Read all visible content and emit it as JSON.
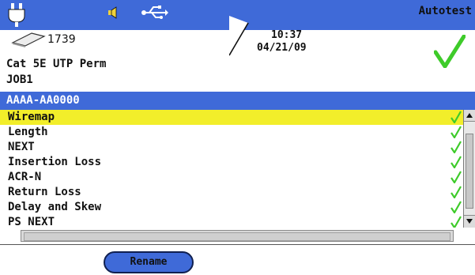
{
  "header": {
    "mode_title": "Autotest",
    "status_icons": [
      "plug-icon",
      "speaker-icon",
      "usb-icon"
    ]
  },
  "info": {
    "counter": "1739",
    "time": "10:37",
    "date": "04/21/09",
    "cable_type": "Cat 5E UTP Perm",
    "job": "JOB1",
    "overall_result_icon": "pass-check-icon"
  },
  "cable_id": "AAAA-AA0000",
  "tests": [
    {
      "label": "Wiremap",
      "result": "pass"
    },
    {
      "label": "Length",
      "result": "pass"
    },
    {
      "label": "NEXT",
      "result": "pass"
    },
    {
      "label": "Insertion Loss",
      "result": "pass"
    },
    {
      "label": "ACR-N",
      "result": "pass"
    },
    {
      "label": "Return Loss",
      "result": "pass"
    },
    {
      "label": "Delay and Skew",
      "result": "pass"
    },
    {
      "label": "PS NEXT",
      "result": "pass"
    }
  ],
  "selected_test": "Wiremap",
  "buttons": {
    "rename": "Rename"
  },
  "colors": {
    "header_blue": "#3f6ad8",
    "selection_yellow": "#f2ee2a",
    "pass_green": "#3ecb2a"
  }
}
